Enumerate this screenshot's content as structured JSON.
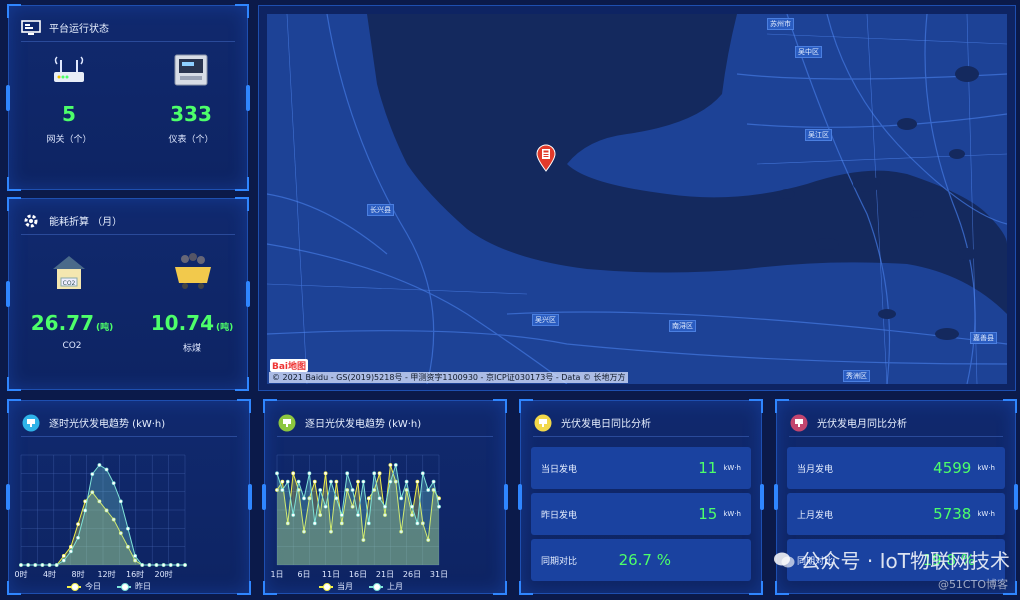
{
  "platform": {
    "title": "平台运行状态",
    "gateways": {
      "value": "5",
      "label": "网关（个）"
    },
    "meters": {
      "value": "333",
      "label": "仪表（个）"
    }
  },
  "energy": {
    "title": "能耗折算 （月）",
    "co2": {
      "value": "26.77",
      "unit": "(吨)",
      "label": "CO2"
    },
    "coal": {
      "value": "10.74",
      "unit": "(吨)",
      "label": "标煤"
    }
  },
  "map": {
    "labels": {
      "suzhou": "苏州市",
      "wuzhong": "吴中区",
      "wujiang": "吴江区",
      "changxing": "长兴县",
      "wuxing": "吴兴区",
      "nanxun": "南浔区",
      "jiashan": "嘉善县",
      "xiuzhou": "秀洲区"
    },
    "copyright": "© 2021 Baidu - GS(2019)5218号 - 甲测资字1100930 - 京ICP证030173号 - Data © 长地万方",
    "logo": "Bai地图"
  },
  "hourly": {
    "title": "逐时光伏发电趋势 (kW·h)",
    "legend": [
      "今日",
      "昨日"
    ]
  },
  "daily": {
    "title": "逐日光伏发电趋势 (kW·h)",
    "legend": [
      "当月",
      "上月"
    ]
  },
  "day_compare": {
    "title": "光伏发电日同比分析",
    "rows": [
      {
        "label": "当日发电",
        "value": "11",
        "unit": "kW·h"
      },
      {
        "label": "昨日发电",
        "value": "15",
        "unit": "kW·h"
      },
      {
        "label": "同期对比",
        "value": "26.7 %",
        "unit": ""
      }
    ]
  },
  "month_compare": {
    "title": "光伏发电月同比分析",
    "rows": [
      {
        "label": "当月发电",
        "value": "4599",
        "unit": "kW·h"
      },
      {
        "label": "上月发电",
        "value": "5738",
        "unit": "kW·h"
      },
      {
        "label": "同期对比",
        "value": "19.8 %",
        "unit": ""
      }
    ]
  },
  "watermark": {
    "main": "公众号 · IoT物联网技术",
    "sub": "@51CTO博客"
  },
  "colors": {
    "accent": "#2f86ff",
    "value": "#4dff6a",
    "yellow": "#f2ef4a",
    "cyan": "#7fe3d8"
  },
  "chart_data": [
    {
      "type": "area",
      "categories": [
        "0时",
        "1",
        "2",
        "3",
        "4时",
        "5",
        "6",
        "7",
        "8时",
        "9",
        "10",
        "11",
        "12时",
        "13",
        "14",
        "15",
        "16时",
        "17",
        "18",
        "19",
        "20时",
        "21",
        "22",
        "23"
      ],
      "series": [
        {
          "name": "今日",
          "values": [
            0,
            0,
            0,
            0,
            0,
            0,
            2,
            4,
            9,
            14,
            16,
            14,
            12,
            10,
            7,
            4,
            1,
            0,
            0,
            0,
            0,
            0,
            0,
            0
          ]
        },
        {
          "name": "昨日",
          "values": [
            0,
            0,
            0,
            0,
            0,
            0,
            1,
            3,
            6,
            12,
            20,
            22,
            21,
            18,
            14,
            8,
            2,
            0,
            0,
            0,
            0,
            0,
            0,
            0
          ]
        }
      ],
      "xticks": [
        "0时",
        "4时",
        "8时",
        "12时",
        "16时",
        "20时"
      ]
    },
    {
      "type": "area",
      "categories": [
        "1日",
        "2",
        "3",
        "4",
        "5",
        "6日",
        "7",
        "8",
        "9",
        "10",
        "11日",
        "12",
        "13",
        "14",
        "15",
        "16日",
        "17",
        "18",
        "19",
        "20",
        "21日",
        "22",
        "23",
        "24",
        "25",
        "26日",
        "27",
        "28",
        "29",
        "30",
        "31日"
      ],
      "series": [
        {
          "name": "当月",
          "values": [
            18,
            20,
            10,
            22,
            18,
            8,
            16,
            20,
            12,
            22,
            8,
            20,
            10,
            18,
            14,
            20,
            6,
            16,
            18,
            22,
            12,
            24,
            20,
            8,
            18,
            12,
            20,
            10,
            6,
            18,
            16
          ]
        },
        {
          "name": "上月",
          "values": [
            22,
            18,
            20,
            12,
            20,
            16,
            22,
            10,
            18,
            14,
            20,
            16,
            12,
            22,
            18,
            12,
            20,
            10,
            22,
            16,
            14,
            20,
            24,
            16,
            20,
            14,
            10,
            22,
            18,
            20,
            14
          ]
        }
      ],
      "xticks": [
        "1日",
        "6日",
        "11日",
        "16日",
        "21日",
        "26日",
        "31日"
      ]
    }
  ]
}
